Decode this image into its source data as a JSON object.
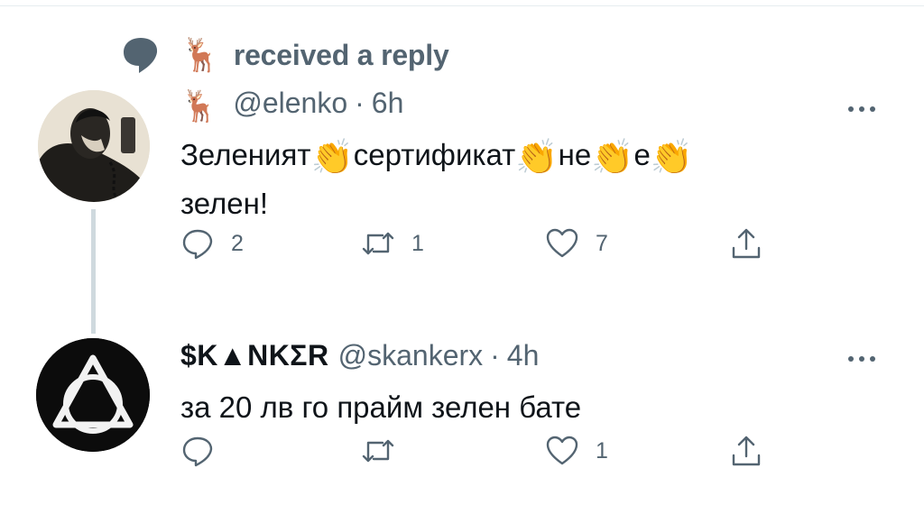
{
  "context": {
    "icon": "speech-bubble-icon",
    "emoji": "🦌",
    "text": "received a reply"
  },
  "tweets": [
    {
      "emoji": "🦌",
      "name": "",
      "handle": "@elenko",
      "dot": "·",
      "time": "6h",
      "text_parts": [
        "Зеленият",
        "сертификат",
        "не",
        "е"
      ],
      "text_line2": "зелен!",
      "clap": "👏",
      "replies": "2",
      "retweets": "1",
      "likes": "7"
    },
    {
      "name": "$K▲NKΣR",
      "handle": "@skankerx",
      "dot": "·",
      "time": "4h",
      "text": "за 20 лв го прайм зелен бате",
      "replies": "",
      "retweets": "",
      "likes": "1"
    }
  ],
  "colors": {
    "text": "#0f1419",
    "secondary": "#536471",
    "thread_line": "#cfd9de"
  }
}
